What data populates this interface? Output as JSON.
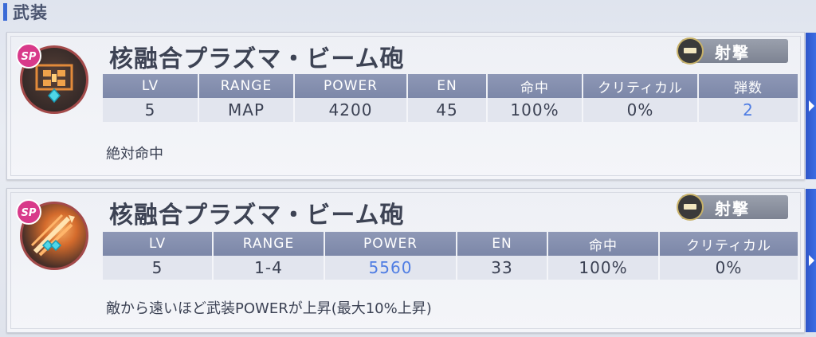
{
  "section": {
    "title": "武装"
  },
  "colors": {
    "accent": "#3b6bd6",
    "header_cell": "#8e98b6",
    "highlight_value": "#4f7de3",
    "card_bg": "#eef0f5"
  },
  "weapons": [
    {
      "name": "核融合プラズマ・ビーム砲",
      "type_label": "射撃",
      "type_icon": "gun-icon",
      "weapon_icon": "map-weapon-icon",
      "badge": "SP",
      "headers": [
        "LV",
        "RANGE",
        "POWER",
        "EN",
        "命中",
        "クリティカル",
        "弾数"
      ],
      "values": [
        "5",
        "MAP",
        "4200",
        "45",
        "100%",
        "0%",
        "2"
      ],
      "highlighted_value_index": 6,
      "description": "絶対命中"
    },
    {
      "name": "核融合プラズマ・ビーム砲",
      "type_label": "射撃",
      "type_icon": "gun-icon",
      "weapon_icon": "beam-blast-icon",
      "badge": "SP",
      "headers": [
        "LV",
        "RANGE",
        "POWER",
        "EN",
        "命中",
        "クリティカル"
      ],
      "values": [
        "5",
        "1-4",
        "5560",
        "33",
        "100%",
        "0%"
      ],
      "highlighted_value_index": 2,
      "description": "敵から遠いほど武装POWERが上昇(最大10%上昇)"
    }
  ]
}
